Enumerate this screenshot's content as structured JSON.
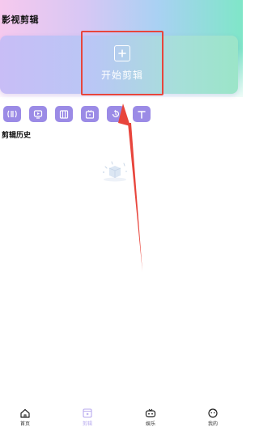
{
  "header": {
    "title": "影视剪辑"
  },
  "start_card": {
    "label": "开始剪辑",
    "icon": "plus-square-icon"
  },
  "toolbar": {
    "accent_color": "#9b8be6",
    "tools": [
      {
        "name": "split-icon"
      },
      {
        "name": "speed-icon"
      },
      {
        "name": "frame-icon"
      },
      {
        "name": "crop-icon"
      },
      {
        "name": "rotate-icon"
      },
      {
        "name": "text-icon"
      }
    ]
  },
  "history": {
    "title": "剪辑历史"
  },
  "annotation": {
    "color": "#e8453c"
  },
  "bottom_nav": {
    "items": [
      {
        "label": "首页",
        "icon": "home-icon",
        "active": false
      },
      {
        "label": "剪辑",
        "icon": "edit-icon",
        "active": true
      },
      {
        "label": "娱乐",
        "icon": "game-icon",
        "active": false
      },
      {
        "label": "我的",
        "icon": "profile-icon",
        "active": false
      }
    ]
  }
}
